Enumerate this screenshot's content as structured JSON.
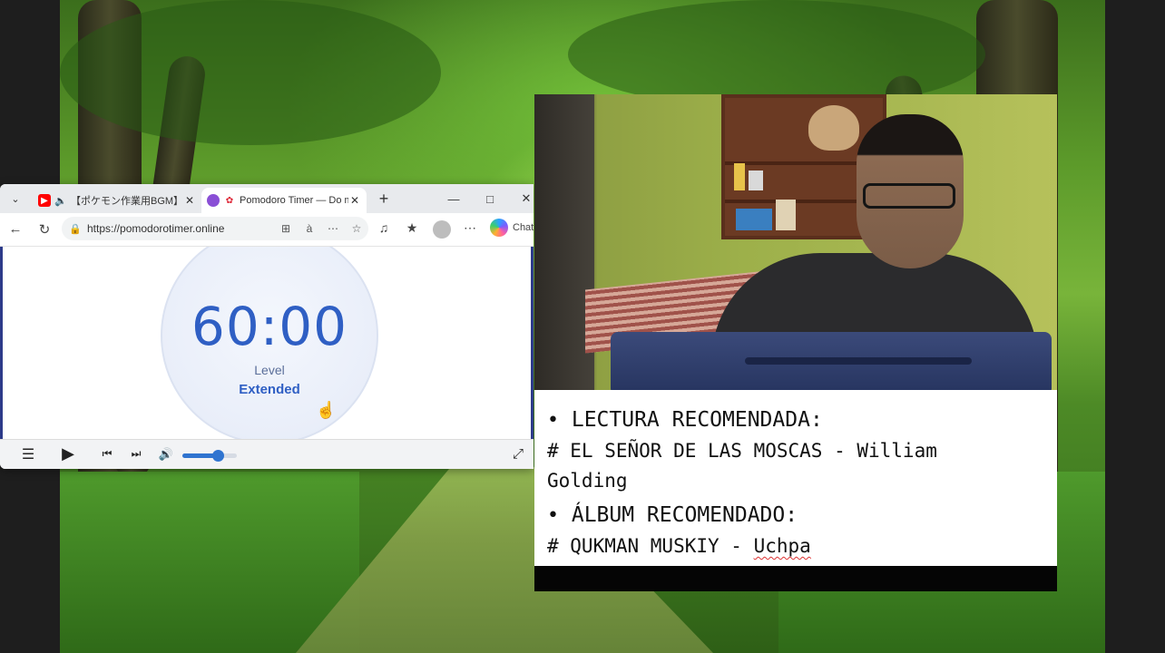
{
  "browser": {
    "tabs": [
      {
        "title": "【ポケモン作業用BGM】楽た",
        "favicon": "youtube-icon",
        "audio": true
      },
      {
        "title": "Pomodoro Timer — Do m",
        "favicon": "pomodoro-icon",
        "active": true
      }
    ],
    "url": "https://pomodorotimer.online",
    "copilot_label": "Chat"
  },
  "timer": {
    "time": "60:00",
    "level_label": "Level",
    "level_value": "Extended"
  },
  "player": {
    "volume": 0.65
  },
  "notes": {
    "reading_heading": "LECTURA RECOMENDADA:",
    "reading_line1": "# EL SEÑOR DE LAS MOSCAS - William",
    "reading_line2": "Golding",
    "album_heading": "ÁLBUM RECOMENDADO:",
    "album_prefix": "# QUKMAN MUSKIY - ",
    "album_artist": "Uchpa"
  },
  "colors": {
    "timer_blue": "#2f5fc4",
    "volume_blue": "#2f74d0"
  }
}
